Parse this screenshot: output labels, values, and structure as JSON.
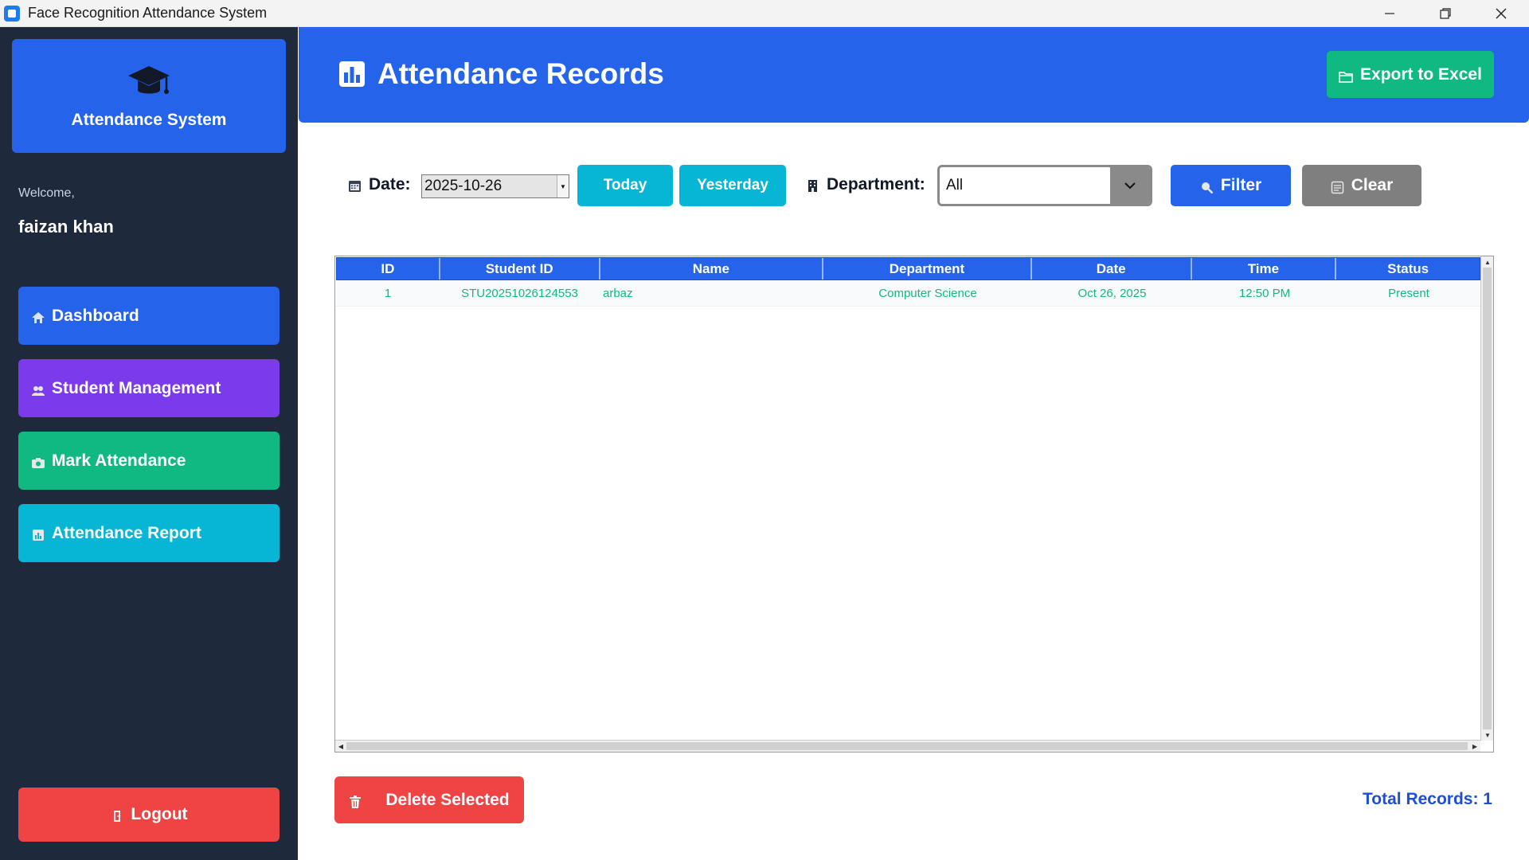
{
  "window": {
    "title": "Face Recognition Attendance System"
  },
  "sidebar": {
    "brand": "Attendance System",
    "welcome": "Welcome,",
    "username": "faizan khan",
    "items": [
      {
        "label": "Dashboard",
        "icon": "home-icon",
        "color": "#2563eb"
      },
      {
        "label": "Student Management",
        "icon": "users-icon",
        "color": "#7c3aed"
      },
      {
        "label": "Mark Attendance",
        "icon": "camera-icon",
        "color": "#10b981"
      },
      {
        "label": "Attendance Report",
        "icon": "report-icon",
        "color": "#06b6d4"
      }
    ],
    "logout": "Logout"
  },
  "header": {
    "title": "Attendance Records",
    "export_label": "Export to Excel"
  },
  "filters": {
    "date_label": "Date:",
    "date_value": "2025-10-26",
    "today_label": "Today",
    "yesterday_label": "Yesterday",
    "department_label": "Department:",
    "department_value": "All",
    "filter_label": "Filter",
    "clear_label": "Clear"
  },
  "table": {
    "columns": [
      "ID",
      "Student ID",
      "Name",
      "Department",
      "Date",
      "Time",
      "Status"
    ],
    "rows": [
      {
        "id": "1",
        "student_id": "STU20251026124553",
        "name": "arbaz",
        "department": "Computer Science",
        "date": "Oct 26, 2025",
        "time": "12:50 PM",
        "status": "Present"
      }
    ]
  },
  "footer": {
    "delete_label": "Delete Selected",
    "total_label": "Total Records: 1"
  },
  "colors": {
    "primary": "#2563eb",
    "sidebar_bg": "#1e293b",
    "success": "#10b981",
    "danger": "#ef4444",
    "cyan": "#06b6d4",
    "purple": "#7c3aed",
    "gray": "#7f7f7f"
  }
}
